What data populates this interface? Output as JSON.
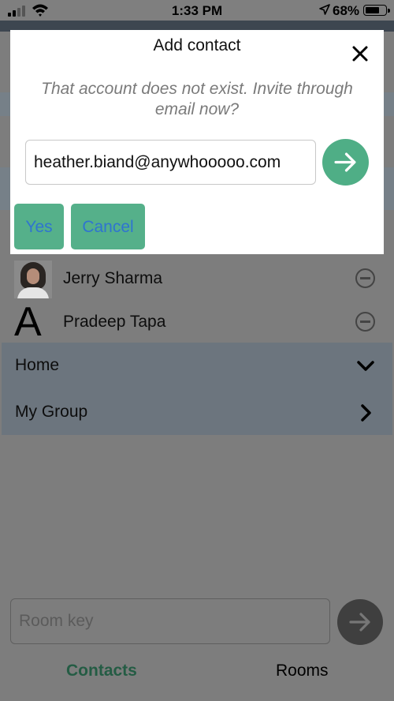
{
  "status_bar": {
    "time": "1:33 PM",
    "battery": "68%"
  },
  "contacts": [
    {
      "name": "Jerry Sharma",
      "avatar": "photo"
    },
    {
      "name": "Pradeep Tapa",
      "avatar_letter": "A"
    }
  ],
  "groups": [
    {
      "label": "Home",
      "icon": "chevron-down-icon"
    },
    {
      "label": "My Group",
      "icon": "chevron-right-icon"
    }
  ],
  "room": {
    "placeholder": "Room key"
  },
  "tabs": [
    {
      "label": "Contacts",
      "active": true
    },
    {
      "label": "Rooms",
      "active": false
    }
  ],
  "modal": {
    "title": "Add contact",
    "message": "That account does not exist.  Invite through email now?",
    "email_value": "heather.biand@anywhooooo.com",
    "yes_label": "Yes",
    "cancel_label": "Cancel"
  },
  "colors": {
    "accent_green": "#4fae86",
    "button_text_blue": "#2f74d0",
    "active_tab": "#245c44"
  }
}
